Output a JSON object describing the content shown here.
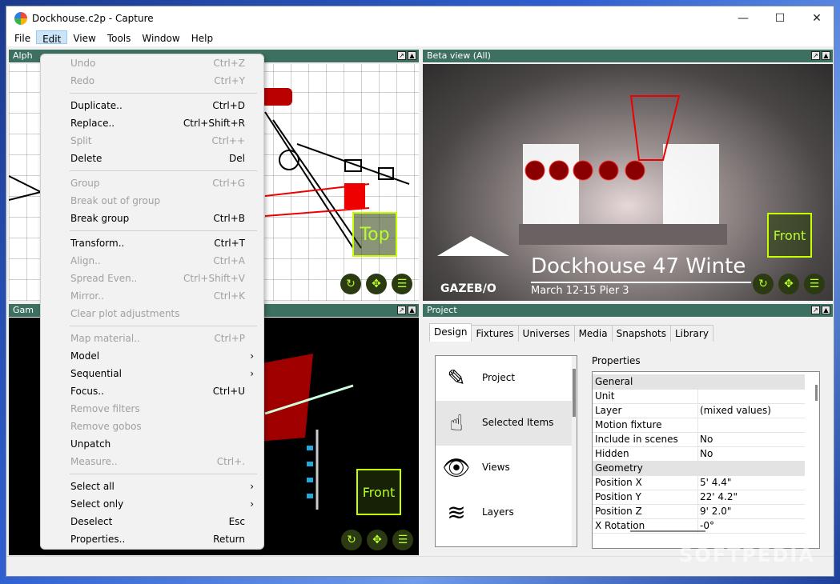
{
  "window": {
    "title": "Dockhouse.c2p - Capture",
    "controls": {
      "minimize": "—",
      "maximize": "☐",
      "close": "✕"
    }
  },
  "menubar": [
    "File",
    "Edit",
    "View",
    "Tools",
    "Window",
    "Help"
  ],
  "panels": {
    "alpha": {
      "title": "Alph"
    },
    "beta": {
      "title": "Beta view  (All)"
    },
    "gamma": {
      "title": "Gam"
    },
    "project": {
      "title": "Project"
    }
  },
  "viewports": {
    "alpha_label": "Top",
    "beta_label": "Front",
    "gamma_label": "Front",
    "beta_screen_title": "Dockhouse 47 Winte",
    "beta_screen_subtitle": "March 12-15 Pier 3",
    "beta_logo": "GAZEB/O"
  },
  "edit_menu": [
    {
      "label": "Undo",
      "shortcut": "Ctrl+Z",
      "disabled": true
    },
    {
      "label": "Redo",
      "shortcut": "Ctrl+Y",
      "disabled": true
    },
    {
      "sep": true
    },
    {
      "label": "Duplicate..",
      "shortcut": "Ctrl+D"
    },
    {
      "label": "Replace..",
      "shortcut": "Ctrl+Shift+R"
    },
    {
      "label": "Split",
      "shortcut": "Ctrl++",
      "disabled": true
    },
    {
      "label": "Delete",
      "shortcut": "Del"
    },
    {
      "sep": true
    },
    {
      "label": "Group",
      "shortcut": "Ctrl+G",
      "disabled": true
    },
    {
      "label": "Break out of group",
      "shortcut": "",
      "disabled": true
    },
    {
      "label": "Break group",
      "shortcut": "Ctrl+B"
    },
    {
      "sep": true
    },
    {
      "label": "Transform..",
      "shortcut": "Ctrl+T"
    },
    {
      "label": "Align..",
      "shortcut": "Ctrl+A",
      "disabled": true
    },
    {
      "label": "Spread Even..",
      "shortcut": "Ctrl+Shift+V",
      "disabled": true
    },
    {
      "label": "Mirror..",
      "shortcut": "Ctrl+K",
      "disabled": true
    },
    {
      "label": "Clear plot adjustments",
      "shortcut": "",
      "disabled": true
    },
    {
      "sep": true
    },
    {
      "label": "Map material..",
      "shortcut": "Ctrl+P",
      "disabled": true
    },
    {
      "label": "Model",
      "shortcut": "",
      "submenu": true
    },
    {
      "label": "Sequential",
      "shortcut": "",
      "submenu": true
    },
    {
      "label": "Focus..",
      "shortcut": "Ctrl+U"
    },
    {
      "label": "Remove filters",
      "shortcut": "",
      "disabled": true
    },
    {
      "label": "Remove gobos",
      "shortcut": "",
      "disabled": true
    },
    {
      "label": "Unpatch",
      "shortcut": ""
    },
    {
      "label": "Measure..",
      "shortcut": "Ctrl+.",
      "disabled": true
    },
    {
      "sep": true
    },
    {
      "label": "Select all",
      "shortcut": "",
      "submenu": true
    },
    {
      "label": "Select only",
      "shortcut": "",
      "submenu": true
    },
    {
      "label": "Deselect",
      "shortcut": "Esc"
    },
    {
      "label": "Properties..",
      "shortcut": "Return"
    }
  ],
  "project": {
    "tabs": [
      "Design",
      "Fixtures",
      "Universes",
      "Media",
      "Snapshots",
      "Library"
    ],
    "active_tab": "Design",
    "design_items": [
      {
        "label": "Project",
        "icon": "project-icon"
      },
      {
        "label": "Selected Items",
        "icon": "selected-items-icon"
      },
      {
        "label": "Views",
        "icon": "eye-icon"
      },
      {
        "label": "Layers",
        "icon": "layers-icon"
      }
    ],
    "properties_title": "Properties",
    "properties": [
      {
        "section": "General"
      },
      {
        "key": "Unit",
        "value": ""
      },
      {
        "key": "Layer",
        "value": "(mixed values)"
      },
      {
        "key": "Motion fixture",
        "value": ""
      },
      {
        "key": "Include in scenes",
        "value": "No"
      },
      {
        "key": "Hidden",
        "value": "No"
      },
      {
        "section": "Geometry"
      },
      {
        "key": "Position X",
        "value": "5' 4.4\""
      },
      {
        "key": "Position Y",
        "value": "22' 4.2\""
      },
      {
        "key": "Position Z",
        "value": "9' 2.0\""
      },
      {
        "key": "X Rotation",
        "value": "-0°"
      }
    ]
  },
  "watermark": "SOFTPEDIA"
}
